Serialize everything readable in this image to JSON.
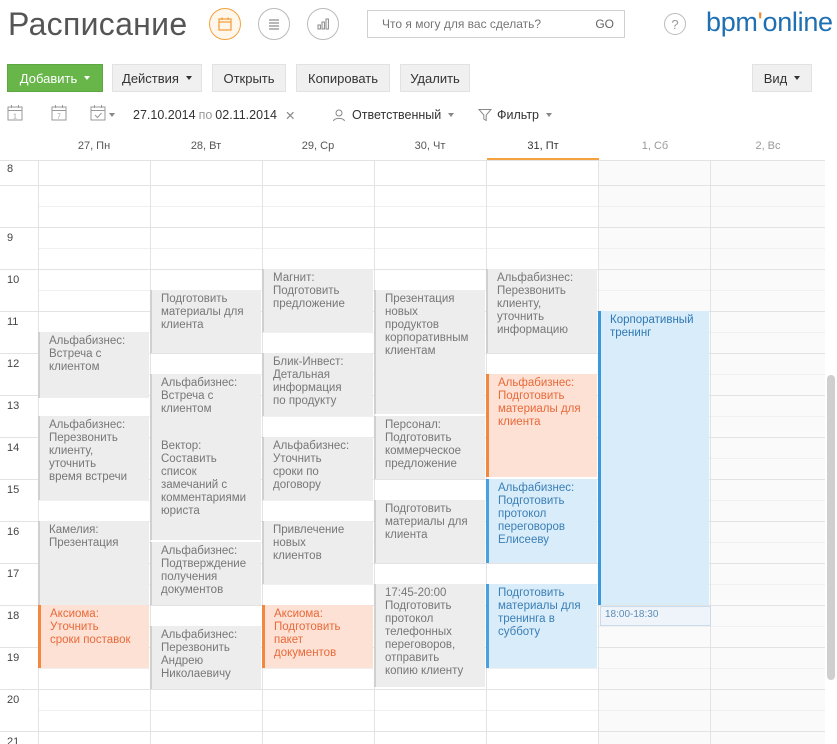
{
  "header": {
    "title": "Расписание",
    "search_placeholder": "Что я могу для вас сделать?",
    "search_go": "GO",
    "help": "?",
    "logo_main": "bpm",
    "logo_accent": "'",
    "logo_tail": "online"
  },
  "toolbar": {
    "add": "Добавить",
    "actions": "Действия",
    "open": "Открыть",
    "copy": "Копировать",
    "delete": "Удалить",
    "view": "Вид"
  },
  "filters": {
    "day_icon_num": "1",
    "week_icon_num": "7",
    "date_from": "27.10.2014",
    "date_sep": "по",
    "date_to": "02.11.2014",
    "clear": "✕",
    "owner": "Ответственный",
    "filter": "Фильтр"
  },
  "days": [
    "27, Пн",
    "28, Вт",
    "29, Ср",
    "30, Чт",
    "31, Пт",
    "1, Сб",
    "2, Вс"
  ],
  "hours": [
    "8",
    "9",
    "10",
    "11",
    "12",
    "13",
    "14",
    "15",
    "16",
    "17",
    "18",
    "19",
    "20",
    "21"
  ],
  "events": {
    "mon1": "Альфабизнес:\nВстреча с\nклиентом",
    "mon2": "Альфабизнес:\nПерезвонить\nклиенту,\nуточнить\nвремя встречи",
    "mon3": "Камелия:\nПрезентация",
    "mon4": "Аксиома:\nУточнить\nсроки поставок",
    "tue1": "Подготовить\nматериалы для\nклиента",
    "tue2": "Альфабизнес:\nВстреча с\nклиентом",
    "tue3": "Вектор:\nСоставить\nсписок\nзамечаний с\nкомментариями\nюриста",
    "tue4": "Альфабизнес:\nПодтверждение\nполучения\nдокументов",
    "tue5": "Альфабизнес:\nПерезвонить\nАндрею\nНиколаевичу",
    "wed1": "Магнит:\nПодготовить\nпредложение",
    "wed2": "Блик-Инвест:\nДетальная\nинформация\nпо продукту",
    "wed3": "Альфабизнес:\nУточнить\nсроки по\nдоговору",
    "wed4": "Привлечение\nновых\nклиентов",
    "wed5": "Аксиома:\nПодготовить\nпакет\nдокументов",
    "thu1": "Презентация\nновых\nпродуктов\nкорпоративным\nклиентам",
    "thu2": "Персонал:\nПодготовить\nкоммерческое\nпредложение",
    "thu3": "Подготовить\nматериалы для\nклиента",
    "thu4": "17:45-20:00 Подготовить\nпротокол\nтелефонных\nпереговоров,\nотправить\nкопию клиенту",
    "fri1": "Альфабизнес:\nПерезвонить\nклиенту,\nуточнить\nинформацию",
    "fri2": "Альфабизнес:\nПодготовить\nматериалы для\nклиента",
    "fri3": "Альфабизнес:\nПодготовить\nпротокол\nпереговоров\nЕлисееву",
    "fri4": "Подготовить\nматериалы для\nтренинга в\nсубботу",
    "sat1": "Корпоративный\nтренинг",
    "sat_time": "18:00-18:30"
  },
  "colors": {
    "accent_green": "#68b54a",
    "accent_orange": "#f4a23f",
    "brand_blue": "#1f6fb2",
    "event_orange": "#fde1d4",
    "event_blue": "#d8ecf9",
    "event_gray": "#ededed"
  }
}
